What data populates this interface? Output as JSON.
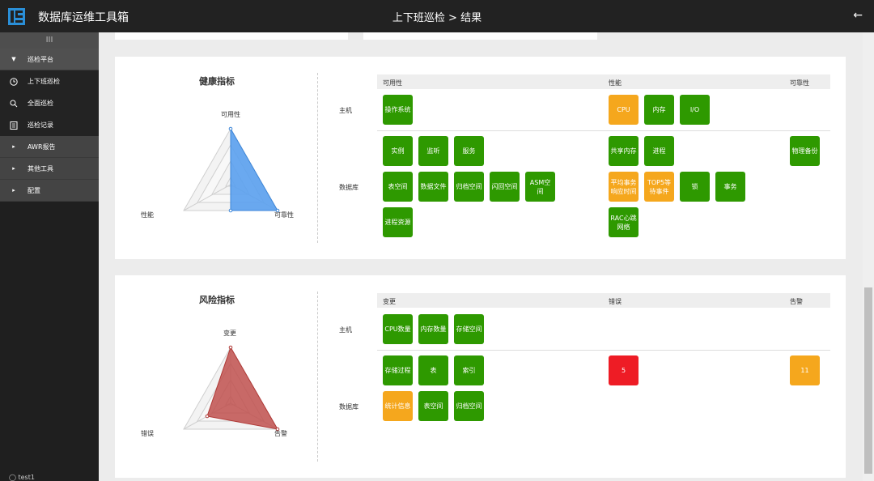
{
  "app": {
    "title": "数据库运维工具箱",
    "page_title": "上下班巡检 > 结果",
    "back_icon": "arrow-left-icon"
  },
  "sidebar": {
    "handle": "III",
    "items": [
      {
        "label": "巡检平台",
        "icon": "caret-down-icon"
      },
      {
        "label": "上下班巡检",
        "icon": "clock-icon"
      },
      {
        "label": "全面巡检",
        "icon": "search-icon"
      },
      {
        "label": "巡检记录",
        "icon": "list-icon"
      },
      {
        "label": "AWR报告",
        "icon": "caret-right-icon"
      },
      {
        "label": "其他工具",
        "icon": "caret-right-icon"
      },
      {
        "label": "配置",
        "icon": "caret-right-icon"
      }
    ],
    "user": "test1"
  },
  "health": {
    "title": "健康指标",
    "axes": {
      "top": "可用性",
      "left": "性能",
      "right": "可靠性"
    },
    "color": "#5aa0ee",
    "columns": [
      "可用性",
      "性能",
      "可靠性"
    ],
    "rows": {
      "host": "主机",
      "db": "数据库"
    },
    "tiles": {
      "host_avail": [
        "操作系统"
      ],
      "host_perf": [
        "CPU",
        "内存",
        "I/O"
      ],
      "db_avail_1": [
        "实例",
        "监听",
        "服务"
      ],
      "db_avail_2": [
        "表空间",
        "数据文件",
        "归档空间",
        "闪回空间",
        "ASM空间"
      ],
      "db_avail_3": [
        "进程资源"
      ],
      "db_perf_1": [
        "共享内存",
        "进程"
      ],
      "db_perf_2": [
        "平均事务响应时间",
        "TOP5等待事件",
        "锁",
        "事务"
      ],
      "db_perf_3": [
        "RAC心跳网络"
      ],
      "db_rel": [
        "物理备份"
      ]
    }
  },
  "risk": {
    "title": "风险指标",
    "axes": {
      "top": "变更",
      "left": "错误",
      "right": "告警"
    },
    "color": "#c0504d",
    "columns": [
      "变更",
      "错误",
      "告警"
    ],
    "rows": {
      "host": "主机",
      "db": "数据库"
    },
    "tiles": {
      "host_change": [
        "CPU数量",
        "内存数量",
        "存储空间"
      ],
      "db_change_1": [
        "存储过程",
        "表",
        "索引"
      ],
      "db_change_2": [
        "统计信息",
        "表空间",
        "归档空间"
      ],
      "db_error": "5",
      "db_alert": "11"
    }
  },
  "colors": {
    "ok": "#2e9900",
    "warn": "#f5a71d",
    "error": "#ee1c25",
    "topbar": "#222222",
    "sidebar": "#1f1f1f"
  }
}
